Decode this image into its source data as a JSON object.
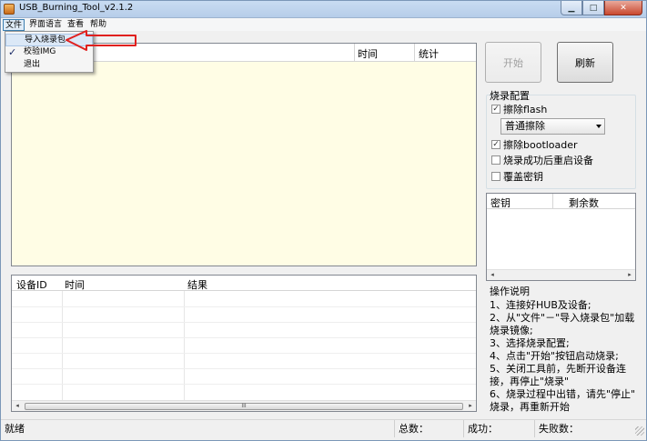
{
  "window": {
    "title": "USB_Burning_Tool_v2.1.2",
    "controls": {
      "minimize": "▁",
      "maximize": "□",
      "close": "✕"
    }
  },
  "menubar": {
    "items": [
      "文件",
      "界面语言",
      "查看",
      "帮助"
    ]
  },
  "file_menu": {
    "items": [
      {
        "label": "导入烧录包",
        "checked": false,
        "highlighted": true
      },
      {
        "label": "校验IMG",
        "checked": true,
        "highlighted": false
      },
      {
        "label": "退出",
        "checked": false,
        "highlighted": false
      }
    ],
    "check_mark": "✓"
  },
  "upper_list": {
    "columns": [
      "时间",
      "统计"
    ]
  },
  "buttons": {
    "start": "开始",
    "refresh": "刷新"
  },
  "burn_config": {
    "title": "烧录配置",
    "erase_flash": {
      "label": "擦除flash",
      "checked": true
    },
    "erase_mode": "普通擦除",
    "erase_bootloader": {
      "label": "擦除bootloader",
      "checked": true
    },
    "reboot_after": {
      "label": "烧录成功后重启设备",
      "checked": false
    },
    "overwrite_key": {
      "label": "覆盖密钥",
      "checked": false
    },
    "check_mark": "✓"
  },
  "key_list": {
    "columns": [
      "密钥",
      "剩余数"
    ],
    "scroll_left": "◂",
    "scroll_right": "▸"
  },
  "instructions": {
    "title": "操作说明",
    "lines": [
      "1、连接好HUB及设备;",
      "2、从\"文件\"－\"导入烧录包\"加载",
      "烧录镜像;",
      "3、选择烧录配置;",
      "4、点击\"开始\"按钮启动烧录;",
      "5、关闭工具前，先断开设备连",
      "接，再停止\"烧录\"",
      "6、烧录过程中出错，请先\"停止\"",
      "烧录，再重新开始"
    ]
  },
  "lower_list": {
    "columns": [
      "设备ID",
      "时间",
      "结果"
    ],
    "scroll_left": "◂",
    "scroll_right": "▸",
    "thumb": "III"
  },
  "statusbar": {
    "status": "就绪",
    "total": "总数：",
    "success": "成功：",
    "failed": "失败数："
  },
  "colors": {
    "upper_list_bg": "#fffde5",
    "annotation_arrow": "#e0201e",
    "titlebar": "#c9dcf2"
  }
}
